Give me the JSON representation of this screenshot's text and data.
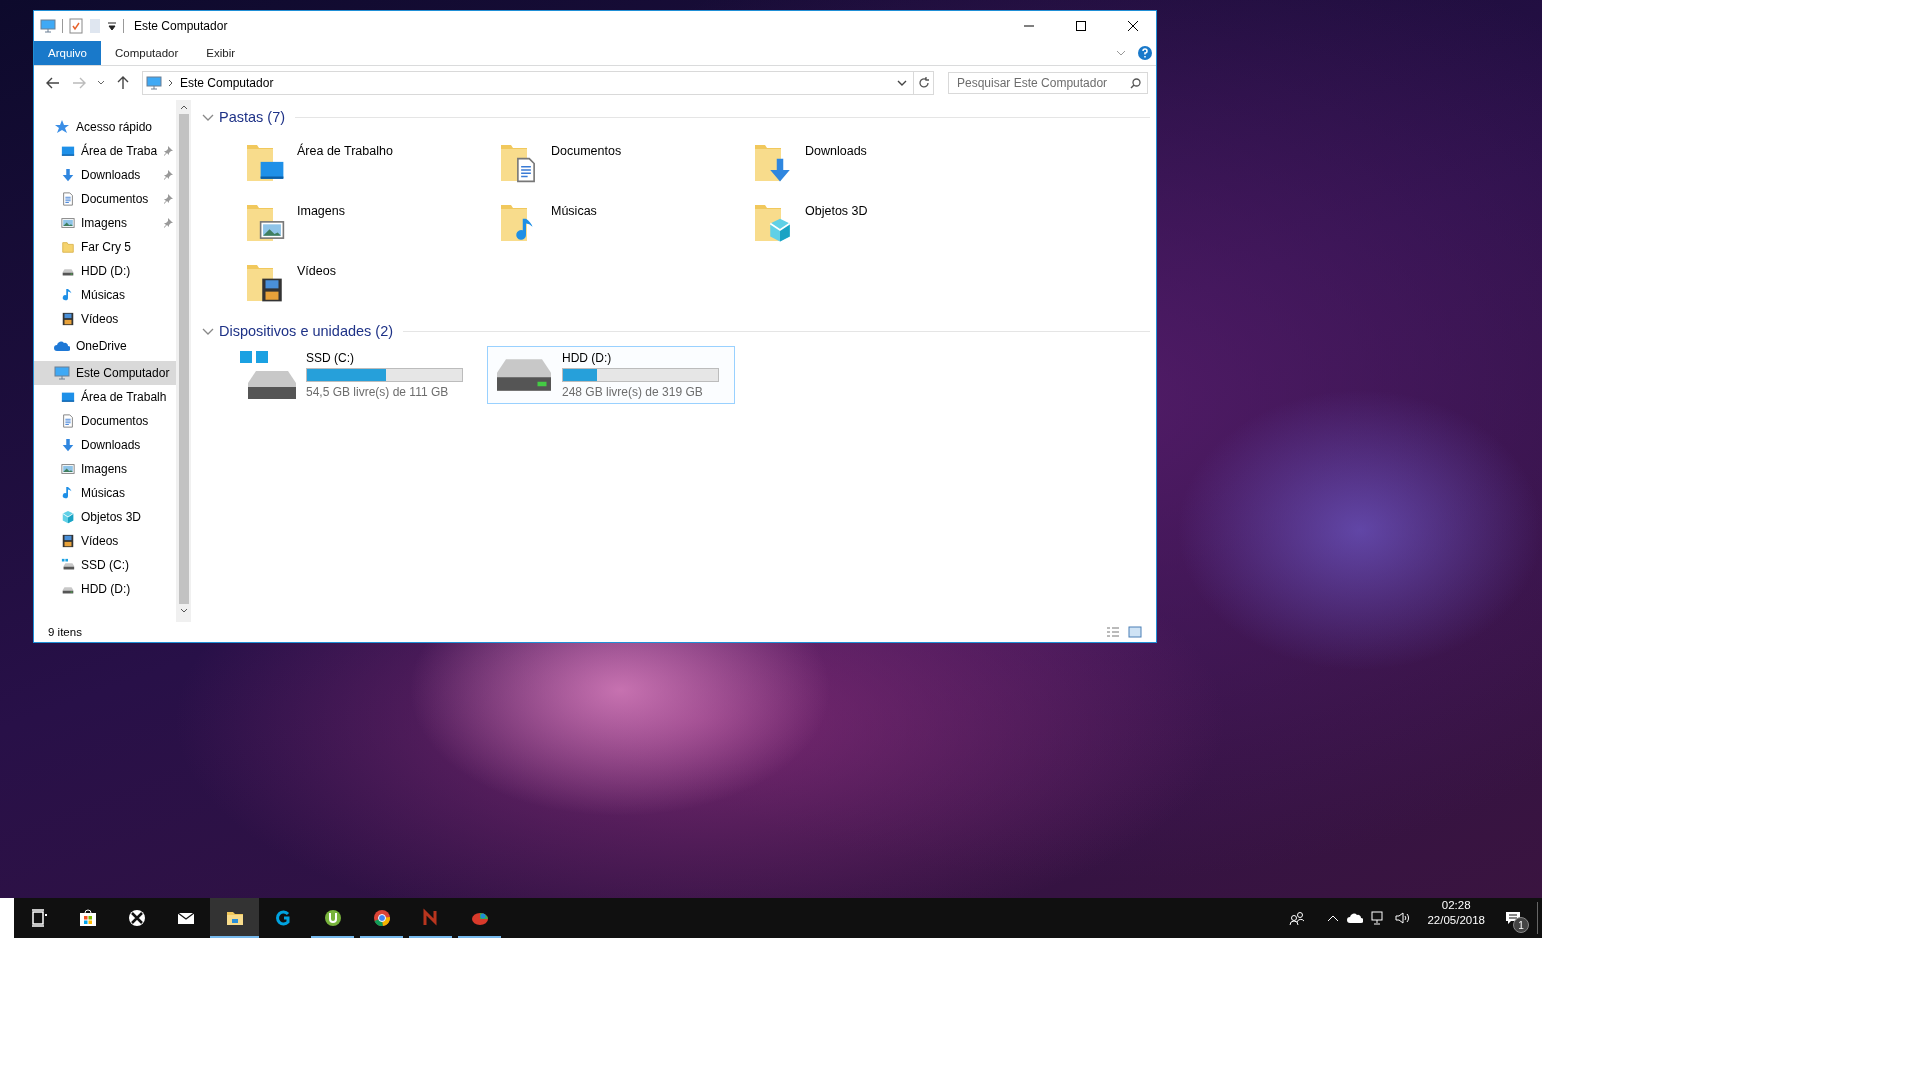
{
  "window": {
    "title": "Este Computador"
  },
  "ribbon_tabs": [
    {
      "label": "Arquivo",
      "selected": true
    },
    {
      "label": "Computador",
      "selected": false
    },
    {
      "label": "Exibir",
      "selected": false
    }
  ],
  "address": {
    "path": "Este Computador"
  },
  "search": {
    "placeholder": "Pesquisar Este Computador"
  },
  "sidebar": {
    "items": [
      {
        "label": "Acesso rápido",
        "kind": "star",
        "selected": false,
        "children": [
          {
            "label": "Área de Traba",
            "kind": "desktop",
            "pinned": true,
            "selected": false
          },
          {
            "label": "Downloads",
            "kind": "download",
            "pinned": true,
            "selected": false
          },
          {
            "label": "Documentos",
            "kind": "documents",
            "pinned": true,
            "selected": false
          },
          {
            "label": "Imagens",
            "kind": "pictures",
            "pinned": true,
            "selected": false
          },
          {
            "label": "Far Cry 5",
            "kind": "folder",
            "pinned": false,
            "selected": false
          },
          {
            "label": "HDD (D:)",
            "kind": "hdd",
            "pinned": false,
            "selected": false
          },
          {
            "label": "Músicas",
            "kind": "music",
            "pinned": false,
            "selected": false
          },
          {
            "label": "Vídeos",
            "kind": "videos",
            "pinned": false,
            "selected": false
          }
        ]
      },
      {
        "label": "OneDrive",
        "kind": "cloud",
        "selected": false
      },
      {
        "label": "Este Computador",
        "kind": "computer",
        "selected": true,
        "children": [
          {
            "label": "Área de Trabalh",
            "kind": "desktop",
            "pinned": false,
            "selected": false
          },
          {
            "label": "Documentos",
            "kind": "documents",
            "pinned": false,
            "selected": false
          },
          {
            "label": "Downloads",
            "kind": "download",
            "pinned": false,
            "selected": false
          },
          {
            "label": "Imagens",
            "kind": "pictures",
            "pinned": false,
            "selected": false
          },
          {
            "label": "Músicas",
            "kind": "music",
            "pinned": false,
            "selected": false
          },
          {
            "label": "Objetos 3D",
            "kind": "cube",
            "pinned": false,
            "selected": false
          },
          {
            "label": "Vídeos",
            "kind": "videos",
            "pinned": false,
            "selected": false
          },
          {
            "label": "SSD (C:)",
            "kind": "ssd",
            "pinned": false,
            "selected": false
          },
          {
            "label": "HDD (D:)",
            "kind": "hdd",
            "pinned": false,
            "selected": false
          }
        ]
      }
    ]
  },
  "sections": [
    {
      "title": "Pastas (7)",
      "expanded": true,
      "folders": [
        {
          "label": "Área de Trabalho",
          "kind": "desktop"
        },
        {
          "label": "Documentos",
          "kind": "documents"
        },
        {
          "label": "Downloads",
          "kind": "download"
        },
        {
          "label": "Imagens",
          "kind": "pictures"
        },
        {
          "label": "Músicas",
          "kind": "music"
        },
        {
          "label": "Objetos 3D",
          "kind": "cube"
        },
        {
          "label": "Vídeos",
          "kind": "videos"
        }
      ]
    },
    {
      "title": "Dispositivos e unidades (2)",
      "expanded": true,
      "drives": [
        {
          "name": "SSD (C:)",
          "kind": "ssd",
          "level": 0.51,
          "free": "54,5 GB livre(s) de 111 GB",
          "selected": false
        },
        {
          "name": "HDD (D:)",
          "kind": "hdd",
          "level": 0.22,
          "free": "248 GB livre(s) de 319 GB",
          "selected": true
        }
      ]
    }
  ],
  "status_bar": {
    "text": "9 itens"
  },
  "taskbar": {
    "apps": [
      {
        "kind": "taskview",
        "active": false,
        "running": false
      },
      {
        "kind": "store",
        "active": false,
        "running": false
      },
      {
        "kind": "xbox",
        "active": false,
        "running": false
      },
      {
        "kind": "mail",
        "active": false,
        "running": false
      },
      {
        "kind": "explorer",
        "active": true,
        "running": true
      },
      {
        "kind": "glogo",
        "active": false,
        "running": false
      },
      {
        "kind": "torrent",
        "active": false,
        "running": true
      },
      {
        "kind": "browser",
        "active": false,
        "running": true
      },
      {
        "kind": "nlogo",
        "active": false,
        "running": true
      },
      {
        "kind": "diskchart",
        "active": false,
        "running": true
      }
    ],
    "clock": {
      "time": "02:28",
      "date": "22/05/2018"
    },
    "notifications": {
      "count": "1"
    }
  }
}
